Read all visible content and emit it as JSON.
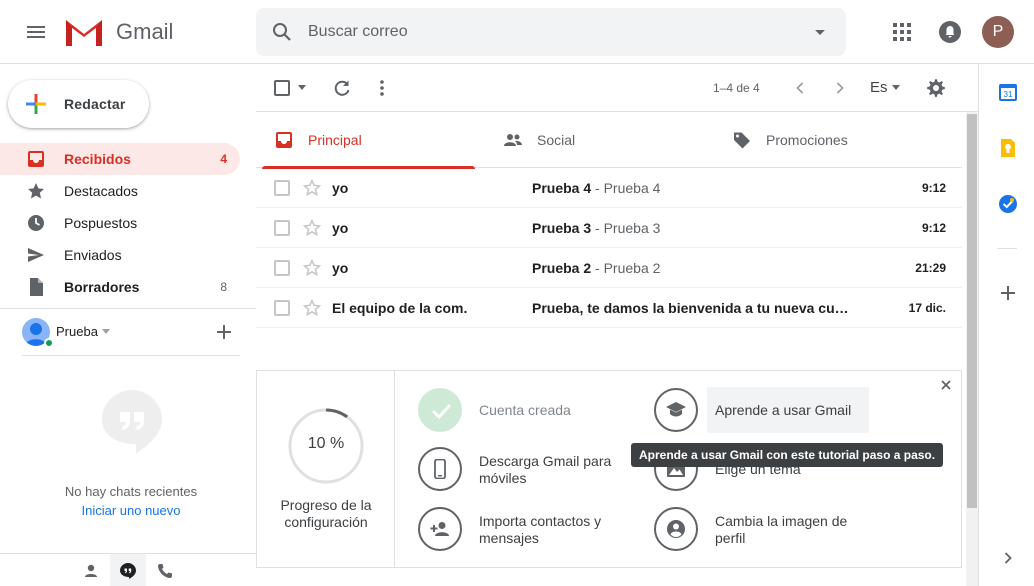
{
  "header": {
    "app_name": "Gmail",
    "search_placeholder": "Buscar correo",
    "avatar_letter": "P"
  },
  "sidebar": {
    "compose_label": "Redactar",
    "items": [
      {
        "label": "Recibidos",
        "count": "4",
        "icon": "inbox-icon"
      },
      {
        "label": "Destacados",
        "count": "",
        "icon": "star-icon"
      },
      {
        "label": "Pospuestos",
        "count": "",
        "icon": "clock-icon"
      },
      {
        "label": "Enviados",
        "count": "",
        "icon": "send-icon"
      },
      {
        "label": "Borradores",
        "count": "8",
        "icon": "draft-icon"
      }
    ],
    "hangouts_user": "Prueba",
    "no_chats": "No hay chats recientes",
    "start_new": "Iniciar uno nuevo"
  },
  "toolbar": {
    "range": "1–4 de 4",
    "language": "Es"
  },
  "tabs": [
    {
      "label": "Principal",
      "icon": "inbox-icon"
    },
    {
      "label": "Social",
      "icon": "people-icon"
    },
    {
      "label": "Promociones",
      "icon": "tag-icon"
    }
  ],
  "emails": [
    {
      "sender": "yo",
      "subject": "Prueba 4",
      "snippet": " - Prueba 4",
      "time": "9:12"
    },
    {
      "sender": "yo",
      "subject": "Prueba 3",
      "snippet": " - Prueba 3",
      "time": "9:12"
    },
    {
      "sender": "yo",
      "subject": "Prueba 2",
      "snippet": " - Prueba 2",
      "time": "21:29"
    },
    {
      "sender": "El equipo de la com.",
      "subject": "Prueba, te damos la bienvenida a tu nueva cuenta de Gmail",
      "snippet": "",
      "time": "17 dic."
    }
  ],
  "setup": {
    "progress_percent": 10,
    "progress_text": "10 %",
    "progress_label_line1": "Progreso de la",
    "progress_label_line2": "configuración",
    "items": {
      "account_created": "Cuenta creada",
      "learn_gmail": "Aprende a usar Gmail",
      "download_line1": "Descarga Gmail para",
      "download_line2": "móviles",
      "theme": "Elige un tema",
      "import_line1": "Importa contactos y",
      "import_line2": "mensajes",
      "profile_line1": "Cambia la imagen de",
      "profile_line2": "perfil"
    },
    "tooltip": "Aprende a usar Gmail con este tutorial paso a paso."
  },
  "colors": {
    "accent_red": "#d93025",
    "active_bg": "#fce8e6",
    "link_blue": "#1a73e8",
    "done_green": "#ceead6"
  }
}
